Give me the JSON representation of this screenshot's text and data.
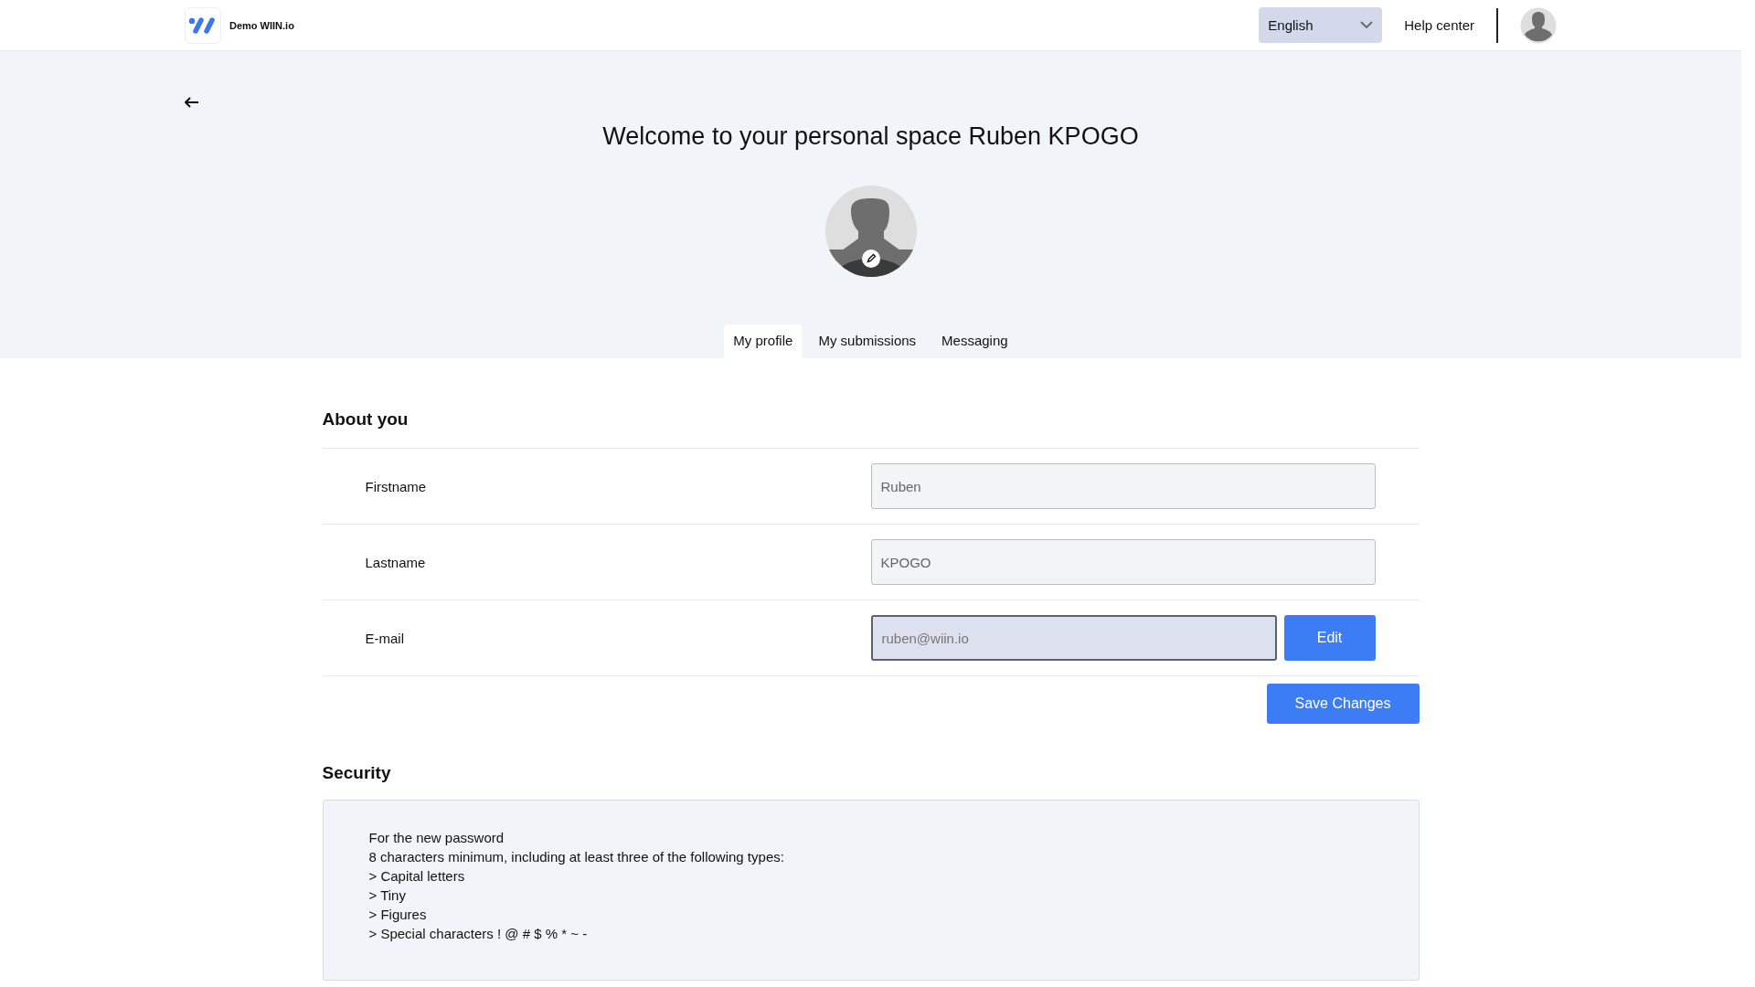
{
  "header": {
    "brand": "Demo WIIN.io",
    "language": "English",
    "help_link": "Help center"
  },
  "title": "Welcome to your personal space Ruben KPOGO",
  "tabs": [
    {
      "label": "My profile",
      "selected": true
    },
    {
      "label": "My submissions",
      "selected": false
    },
    {
      "label": "Messaging",
      "selected": false
    }
  ],
  "about": {
    "heading": "About you",
    "fields": [
      {
        "label": "Firstname",
        "value": "Ruben",
        "disabled": false
      },
      {
        "label": "Lastname",
        "value": "KPOGO",
        "disabled": false
      },
      {
        "label": "E-mail",
        "value": "ruben@wiin.io",
        "disabled": true,
        "action": "Edit"
      }
    ],
    "save_button": "Save Changes"
  },
  "security": {
    "heading": "Security",
    "rules": [
      "For the new password",
      "8 characters minimum, including at least three of the following types:",
      "> Capital letters",
      "> Tiny",
      "> Figures",
      "> Special characters ! @ # $ % * ~ -"
    ]
  }
}
